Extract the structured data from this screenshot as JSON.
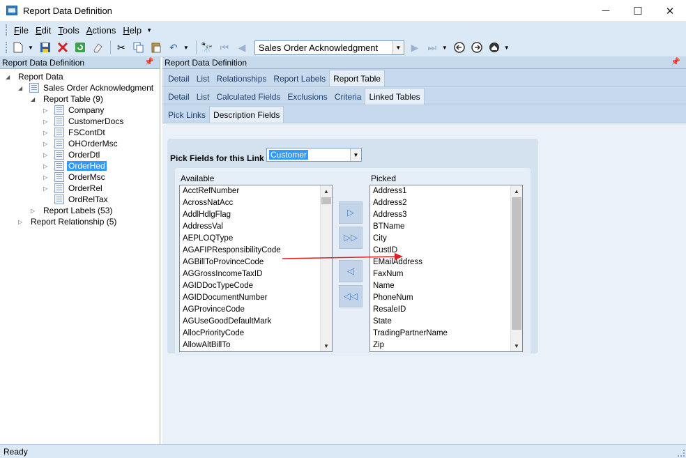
{
  "window": {
    "title": "Report Data Definition",
    "minimize": "─",
    "maximize": "☐",
    "close": "✕"
  },
  "menu": [
    "File",
    "Edit",
    "Tools",
    "Actions",
    "Help"
  ],
  "toolbar": {
    "record_combo": "Sales Order Acknowledgment"
  },
  "left_panel": {
    "header": "Report Data Definition",
    "tree": {
      "root": "Report Data",
      "report": "Sales Order Acknowledgment",
      "report_table": "Report Table (9)",
      "tables": [
        "Company",
        "CustomerDocs",
        "FSContDt",
        "OHOrderMsc",
        "OrderDtl",
        "OrderHed",
        "OrderMsc",
        "OrderRel",
        "OrdRelTax"
      ],
      "selected_table": "OrderHed",
      "report_labels": "Report Labels (53)",
      "report_relationship": "Report Relationship (5)"
    }
  },
  "right_panel": {
    "header": "Report Data Definition",
    "tabs_row1": [
      "Detail",
      "List",
      "Relationships",
      "Report Labels",
      "Report Table"
    ],
    "active_tab_row1": "Report Table",
    "tabs_row2": [
      "Detail",
      "List",
      "Calculated Fields",
      "Exclusions",
      "Criteria",
      "Linked Tables"
    ],
    "active_tab_row2": "Linked Tables",
    "tabs_row3": [
      "Pick Links",
      "Description Fields"
    ],
    "active_tab_row3": "Description Fields",
    "pick_fields_label": "Pick Fields for this Link",
    "pick_fields_value": "Customer",
    "available_title": "Available",
    "picked_title": "Picked",
    "available": [
      "AcctRefNumber",
      "AcrossNatAcc",
      "AddlHdlgFlag",
      "AddressVal",
      "AEPLOQType",
      "AGAFIPResponsibilityCode",
      "AGBillToProvinceCode",
      "AGGrossIncomeTaxID",
      "AGIDDocTypeCode",
      "AGIDDocumentNumber",
      "AGProvinceCode",
      "AGUseGoodDefaultMark",
      "AllocPriorityCode",
      "AllowAltBillTo"
    ],
    "picked": [
      "Address1",
      "Address2",
      "Address3",
      "BTName",
      "City",
      "CustID",
      "EMailAddress",
      "FaxNum",
      "Name",
      "PhoneNum",
      "ResaleID",
      "State",
      "TradingPartnerName",
      "Zip"
    ]
  },
  "status": {
    "text": "Ready"
  },
  "colors": {
    "accent": "#3399ff",
    "annotation_arrow": "#e02020"
  }
}
